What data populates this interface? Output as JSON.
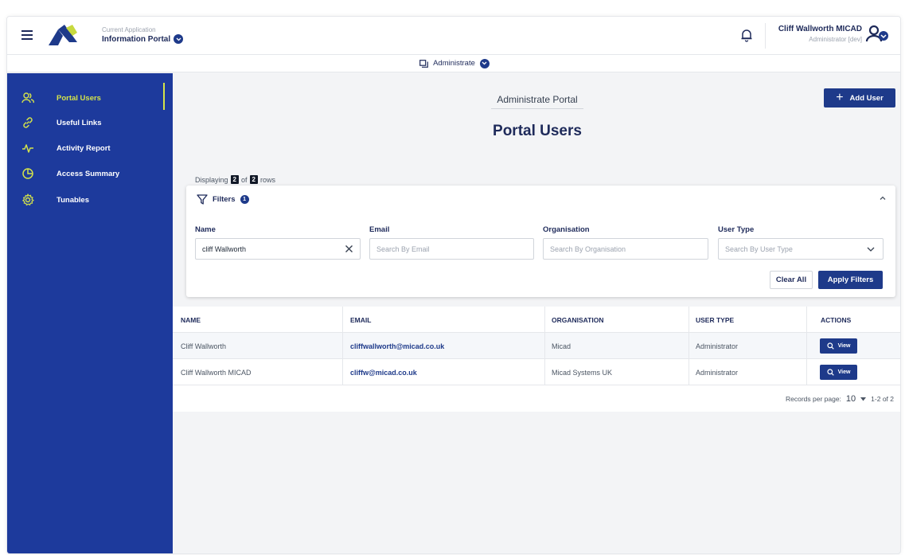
{
  "header": {
    "app_caption": "Current Application",
    "app_name": "Information Portal",
    "user_name": "Cliff Wallworth MICAD",
    "user_role": "Administrator [dev]"
  },
  "admin_bar": {
    "label": "Administrate"
  },
  "sidebar": {
    "items": [
      {
        "label": "Portal Users",
        "icon": "users-icon",
        "active": true
      },
      {
        "label": "Useful Links",
        "icon": "link-icon"
      },
      {
        "label": "Activity Report",
        "icon": "activity-icon"
      },
      {
        "label": "Access Summary",
        "icon": "pie-chart-icon"
      },
      {
        "label": "Tunables",
        "icon": "gear-icon"
      }
    ]
  },
  "main": {
    "section_title": "Administrate Portal",
    "page_title": "Portal Users",
    "add_user_label": "Add User",
    "displaying": {
      "prefix": "Displaying",
      "shown": "2",
      "of": "of",
      "total": "2",
      "suffix": "rows"
    }
  },
  "filters": {
    "title": "Filters",
    "active_count": "1",
    "fields": [
      {
        "label": "Name",
        "value": "cliff Wallworth",
        "placeholder": ""
      },
      {
        "label": "Email",
        "value": "",
        "placeholder": "Search By Email"
      },
      {
        "label": "Organisation",
        "value": "",
        "placeholder": "Search By Organisation"
      },
      {
        "label": "User Type",
        "value": "",
        "placeholder": "Search By User Type"
      }
    ],
    "clear_label": "Clear All",
    "apply_label": "Apply Filters"
  },
  "table": {
    "columns": [
      "NAME",
      "EMAIL",
      "ORGANISATION",
      "USER TYPE",
      "ACTIONS"
    ],
    "rows": [
      {
        "name": "Cliff Wallworth",
        "email": "cliffwallworth@micad.co.uk",
        "organisation": "Micad",
        "user_type": "Administrator",
        "action": "View"
      },
      {
        "name": "Cliff Wallworth MICAD",
        "email": "cliffw@micad.co.uk",
        "organisation": "Micad Systems UK",
        "user_type": "Administrator",
        "action": "View"
      }
    ],
    "pager": {
      "label": "Records per page:",
      "per_page": "10",
      "range": "1-2 of 2"
    }
  },
  "colors": {
    "primary": "#1e3a8a",
    "sidebar": "#1d3a9c",
    "accent": "#d4e34a"
  }
}
